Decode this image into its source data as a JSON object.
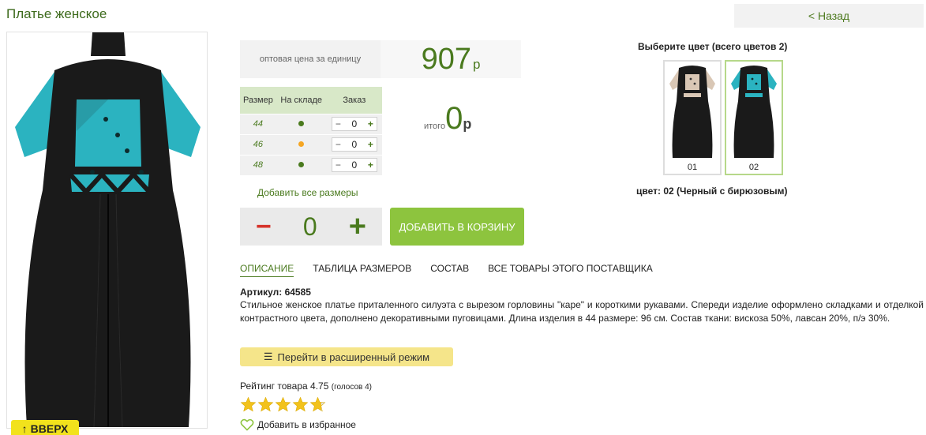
{
  "product": {
    "title": "Платье женское",
    "back_label": "< Назад",
    "up_label": "ВВЕРХ"
  },
  "price": {
    "label": "оптовая цена за единицу",
    "value": "907",
    "currency": "р"
  },
  "size_table": {
    "headers": [
      "Размер",
      "На складе",
      "Заказ"
    ],
    "rows": [
      {
        "size": "44",
        "stock_color": "#4a7a1e",
        "qty": "0"
      },
      {
        "size": "46",
        "stock_color": "#f5a623",
        "qty": "0"
      },
      {
        "size": "48",
        "stock_color": "#4a7a1e",
        "qty": "0"
      }
    ],
    "minus": "−",
    "plus": "+"
  },
  "total": {
    "label": "итого",
    "value": "0",
    "currency": "р"
  },
  "add_all_label": "Добавить все размеры",
  "quantity": {
    "minus": "−",
    "value": "0",
    "plus": "+"
  },
  "cart_button": "ДОБАВИТЬ В КОРЗИНУ",
  "tabs": [
    {
      "label": "ОПИСАНИЕ",
      "active": true
    },
    {
      "label": "ТАБЛИЦА РАЗМЕРОВ",
      "active": false
    },
    {
      "label": "СОСТАВ",
      "active": false
    },
    {
      "label": "ВСЕ ТОВАРЫ ЭТОГО ПОСТАВЩИКА",
      "active": false
    }
  ],
  "article": "Артикул: 64585",
  "description": "Стильное женское платье приталенного силуэта с вырезом горловины \"каре\" и короткими рукавами. Спереди  изделие оформлено складками и отделкой контрастного цвета, дополнено декоративными пуговицами. Длина изделия в 44 размере: 96 см.  Состав ткани: вискоза 50%, лавсан 20%, п/э 30%.",
  "advanced_button": "Перейти в расширенный режим",
  "rating": {
    "label": "Рейтинг товара 4.75",
    "votes": "(голосов 4)",
    "value": 4.75,
    "max": 5
  },
  "favorite_label": "Добавить в избранное",
  "colors": {
    "title": "Выберите цвет (всего цветов 2)",
    "items": [
      {
        "code": "01",
        "accent": "#d9c7b5",
        "selected": false
      },
      {
        "code": "02",
        "accent": "#2bb3c0",
        "selected": true
      }
    ],
    "selected_label": "цвет: 02 (Черный с бирюзовым)"
  },
  "palette": {
    "accent_green": "#4a7a1e",
    "button_green": "#8dc43e",
    "turquoise": "#2bb3c0",
    "dress_black": "#1a1a1a"
  }
}
